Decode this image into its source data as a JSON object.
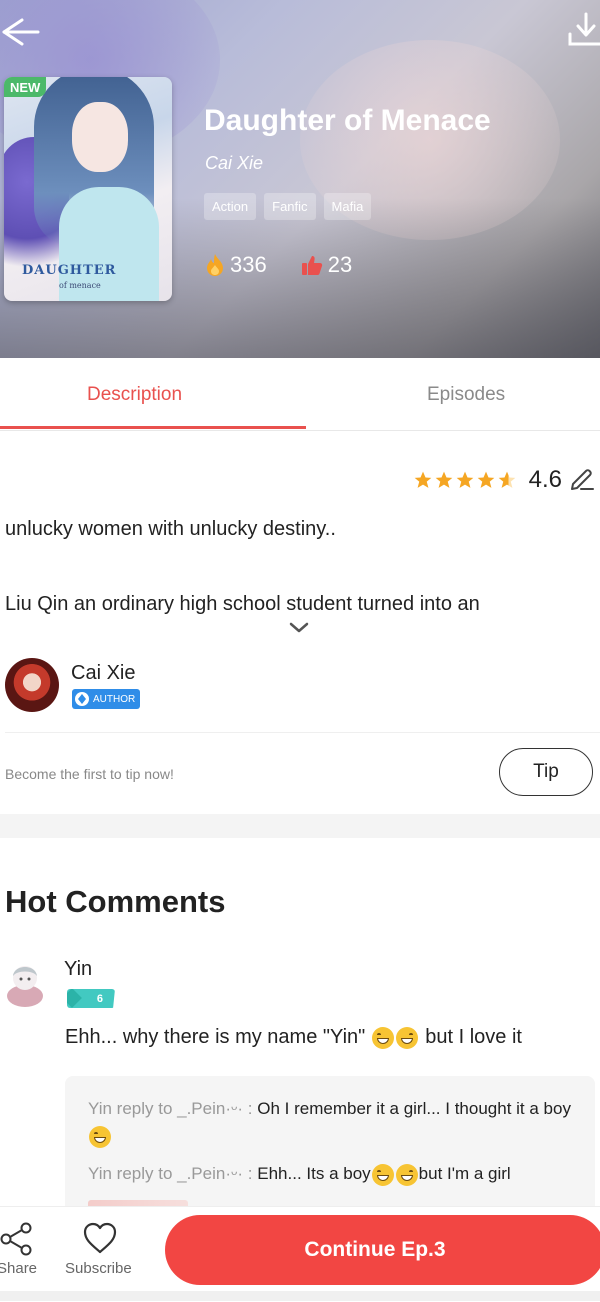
{
  "hero": {
    "new_badge": "NEW",
    "cover_title": "DAUGHTER",
    "cover_subtitle": "of menace",
    "title": "Daughter of Menace",
    "author": "Cai Xie",
    "tags": [
      "Action",
      "Fanfic",
      "Mafia"
    ],
    "hot_count": "336",
    "like_count": "23"
  },
  "tabs": {
    "description": "Description",
    "episodes": "Episodes",
    "active": "description"
  },
  "rating": {
    "value": "4.6",
    "stars": 4.6
  },
  "description": {
    "line1": "unlucky women with unlucky destiny..",
    "line2": "Liu Qin an ordinary high school student turned into an"
  },
  "author": {
    "name": "Cai Xie",
    "badge": "AUTHOR"
  },
  "tip": {
    "prompt": "Become the first to tip now!",
    "button": "Tip"
  },
  "comments": {
    "title": "Hot Comments",
    "items": [
      {
        "user": "Yin",
        "level": "6",
        "text_before": "Ehh... why there is my name \"Yin\"",
        "text_after": "but I love it",
        "replies": [
          {
            "who": "Yin reply to _.Pein·ᵕ· :",
            "text": " Oh I remember it a girl... I thought it a boy"
          },
          {
            "who": "Yin reply to _.Pein·ᵕ· :",
            "text": " Ehh... Its a boy",
            "text_after": "but I'm a girl"
          }
        ]
      }
    ]
  },
  "bottom_bar": {
    "share": "Share",
    "subscribe": "Subscribe",
    "continue": "Continue Ep.3"
  },
  "colors": {
    "accent": "#e9514e",
    "continue_button": "#f24643",
    "new_badge": "#4cb96a",
    "author_badge": "#2f8de8",
    "level_badge": "#42c9c1",
    "star": "#f5a623"
  },
  "icons": {
    "back": "arrow-left-icon",
    "download": "download-icon",
    "hot": "flame-icon",
    "like": "thumbs-up-icon",
    "edit": "pencil-icon",
    "expand": "chevron-down-icon",
    "share": "share-icon",
    "subscribe": "heart-icon"
  }
}
